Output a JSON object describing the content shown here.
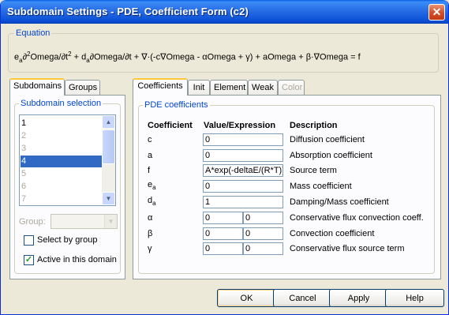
{
  "window": {
    "title": "Subdomain Settings - PDE, Coefficient Form (c2)",
    "close_glyph": "✕"
  },
  "equation": {
    "legend": "Equation",
    "text_parts": [
      "e",
      "a",
      "∂",
      "2",
      "Omega/∂t",
      "2",
      " + d",
      "a",
      "∂Omega/∂t + ∇·(-c∇Omega - αOmega + γ) + aOmega + β·∇Omega = f"
    ]
  },
  "left_tabs": [
    "Subdomains",
    "Groups"
  ],
  "subdomain_selection": {
    "legend": "Subdomain selection",
    "items": [
      {
        "label": "1",
        "state": "normal"
      },
      {
        "label": "2",
        "state": "dim"
      },
      {
        "label": "3",
        "state": "dim"
      },
      {
        "label": "4",
        "state": "selected"
      },
      {
        "label": "5",
        "state": "dim"
      },
      {
        "label": "6",
        "state": "dim"
      },
      {
        "label": "7",
        "state": "dim"
      }
    ],
    "group_label": "Group:",
    "group_value": "",
    "select_by_group_label": "Select by group",
    "select_by_group_checked": false,
    "active_label": "Active in this domain",
    "active_checked": true
  },
  "right_tabs": [
    {
      "label": "Coefficients",
      "state": "active"
    },
    {
      "label": "Init",
      "state": "normal"
    },
    {
      "label": "Element",
      "state": "normal"
    },
    {
      "label": "Weak",
      "state": "normal"
    },
    {
      "label": "Color",
      "state": "disabled"
    }
  ],
  "pde_coefficients": {
    "legend": "PDE coefficients",
    "headers": {
      "coefficient": "Coefficient",
      "value": "Value/Expression",
      "description": "Description"
    },
    "rows": [
      {
        "symbol": "c",
        "sub": "",
        "values": [
          "0"
        ],
        "description": "Diffusion coefficient"
      },
      {
        "symbol": "a",
        "sub": "",
        "values": [
          "0"
        ],
        "description": "Absorption coefficient"
      },
      {
        "symbol": "f",
        "sub": "",
        "values": [
          "A*exp(-deltaE/(R*T))"
        ],
        "description": "Source term"
      },
      {
        "symbol": "e",
        "sub": "a",
        "values": [
          "0"
        ],
        "description": "Mass coefficient"
      },
      {
        "symbol": "d",
        "sub": "a",
        "values": [
          "1"
        ],
        "description": "Damping/Mass coefficient"
      },
      {
        "symbol": "α",
        "sub": "",
        "values": [
          "0",
          "0"
        ],
        "description": "Conservative flux convection coeff."
      },
      {
        "symbol": "β",
        "sub": "",
        "values": [
          "0",
          "0"
        ],
        "description": "Convection coefficient"
      },
      {
        "symbol": "γ",
        "sub": "",
        "values": [
          "0",
          "0"
        ],
        "description": "Conservative flux source term"
      }
    ]
  },
  "buttons": {
    "ok": "OK",
    "cancel": "Cancel",
    "apply": "Apply",
    "help": "Help"
  },
  "colors": {
    "title_bar": "#0b4fd6",
    "selection": "#316ac5",
    "legend": "#0046d5",
    "check": "#21a121"
  }
}
